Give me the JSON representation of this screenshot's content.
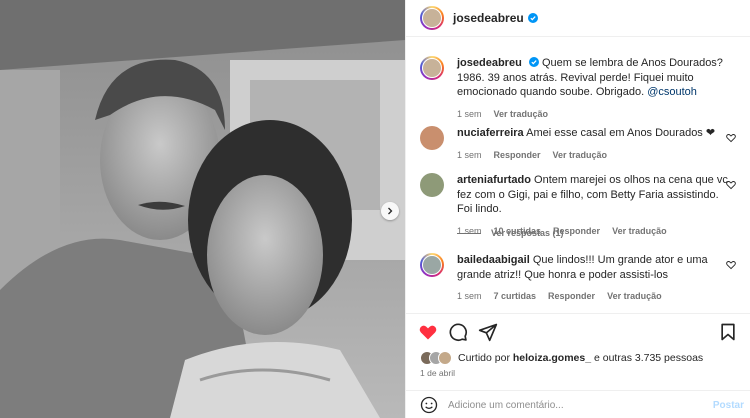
{
  "post": {
    "author": "josedeabreu",
    "caption_text": "Quem se lembra de Anos Dourados? 1986. 39 anos atrás. Revival perde! Fiquei muito emocionado quando soube. Obrigado.",
    "caption_mention": "@csoutoh",
    "caption_time": "1 sem",
    "caption_translate": "Ver tradução"
  },
  "comments": [
    {
      "user": "nuciaferreira",
      "text": "Amei esse casal em Anos Dourados ❤",
      "time": "1 sem",
      "likes": "",
      "reply": "Responder",
      "translate": "Ver tradução"
    },
    {
      "user": "arteniafurtado",
      "text": "Ontem marejei os olhos na cena que vc fez com o Gigi, pai e filho, com Betty Faria assistindo. Foi lindo.",
      "time": "1 sem",
      "likes": "10 curtidas",
      "reply": "Responder",
      "translate": "Ver tradução",
      "view_replies": "Ver respostas (1)"
    },
    {
      "user": "bailedaabigail",
      "text": "Que lindos!!! Um grande ator e uma grande atriz!! Que honra e poder assisti-los",
      "time": "1 sem",
      "likes": "7 curtidas",
      "reply": "Responder",
      "translate": "Ver tradução"
    }
  ],
  "likes": {
    "prefix": "Curtido por",
    "user": "heloiza.gomes_",
    "suffix": "e outras 3.735 pessoas"
  },
  "date": "1 de abril",
  "add_comment": {
    "placeholder": "Adicione um comentário...",
    "post_label": "Postar"
  },
  "colors": {
    "like_red": "#ff3040",
    "verified_blue": "#0095f6",
    "link": "#00376b",
    "muted": "#737373"
  }
}
